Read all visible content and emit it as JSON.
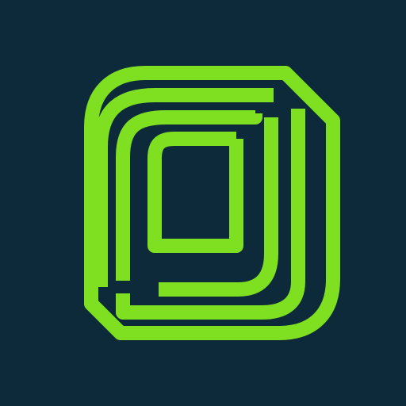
{
  "app_icon": {
    "logo_icon": "nested-rounded-squares-logo-icon",
    "colors": {
      "background": "#0d2a3a",
      "logo_stroke": "#7fe021"
    }
  }
}
